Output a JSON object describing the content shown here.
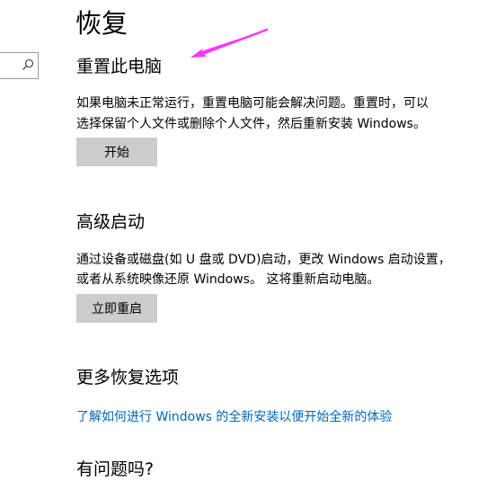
{
  "page": {
    "title": "恢复"
  },
  "reset": {
    "heading": "重置此电脑",
    "description_line1": "如果电脑未正常运行，重置电脑可能会解决问题。重置时，可以",
    "description_line2": "选择保留个人文件或删除个人文件，然后重新安装 Windows。",
    "button_label": "开始"
  },
  "advanced": {
    "heading": "高级启动",
    "description_line1": "通过设备或磁盘(如 U 盘或 DVD)启动，更改 Windows 启动设置，",
    "description_line2": "或者从系统映像还原 Windows。 这将重新启动电脑。",
    "button_label": "立即重启"
  },
  "more": {
    "heading": "更多恢复选项",
    "link_text": "了解如何进行 Windows 的全新安装以便开始全新的体验"
  },
  "help": {
    "heading": "有问题吗?"
  },
  "colors": {
    "link": "#0067b8",
    "button_bg": "#cccccc",
    "annotation_arrow": "#ff33ff"
  },
  "icons": {
    "search": "search-icon",
    "annotation": "pointer-arrow-icon"
  }
}
